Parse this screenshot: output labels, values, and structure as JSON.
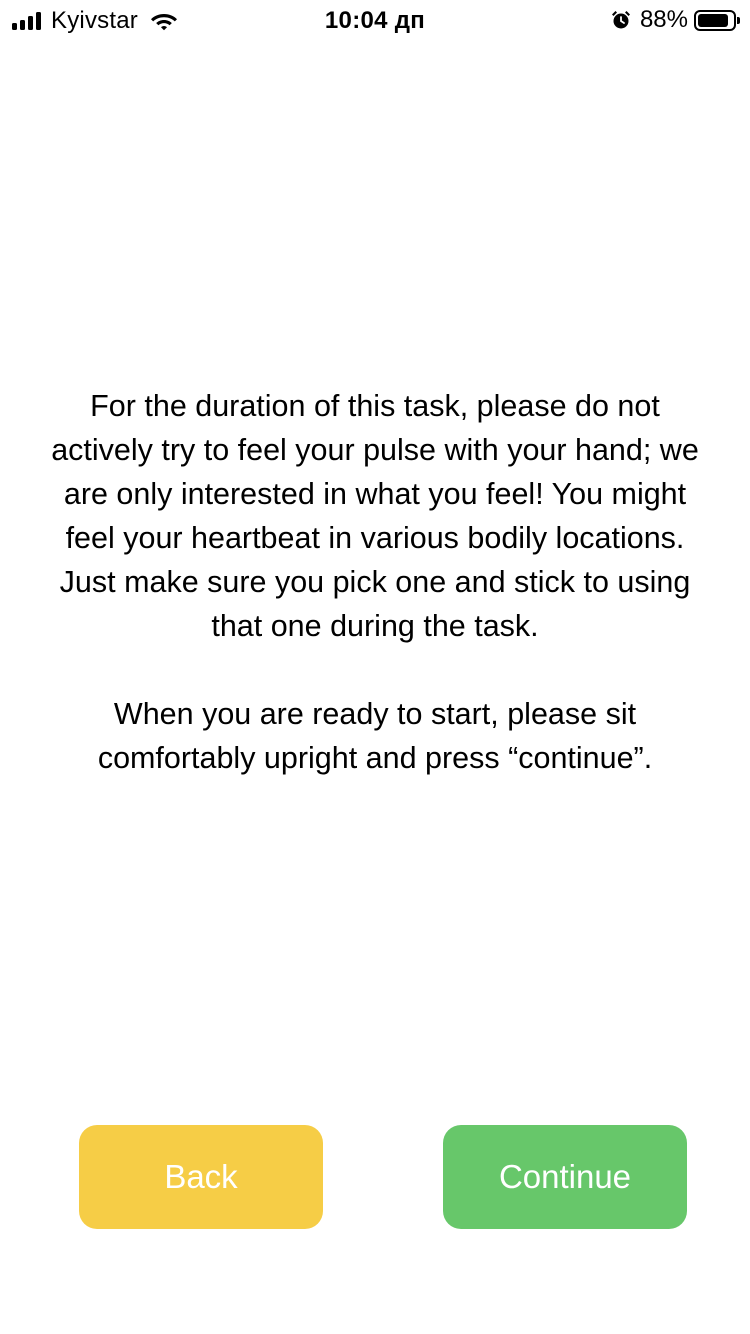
{
  "status_bar": {
    "carrier": "Kyivstar",
    "time": "10:04 дп",
    "battery_percent": "88%",
    "battery_level": 0.88,
    "icons": [
      "signal-icon",
      "wifi-icon",
      "alarm-icon",
      "battery-icon"
    ]
  },
  "instructions": {
    "paragraph_1": "For the duration of this task, please do not actively try to feel your pulse with your hand; we are only interested in what you feel! You might feel your heartbeat in various bodily locations. Just make sure you pick one and stick to using that one during the task.",
    "paragraph_2": "When you are ready to start, please sit comfortably upright and press “continue”."
  },
  "buttons": {
    "back_label": "Back",
    "continue_label": "Continue"
  },
  "colors": {
    "back_button": "#F6CD46",
    "continue_button": "#67C76A",
    "button_text": "#FFFFFF",
    "background": "#FFFFFF"
  }
}
